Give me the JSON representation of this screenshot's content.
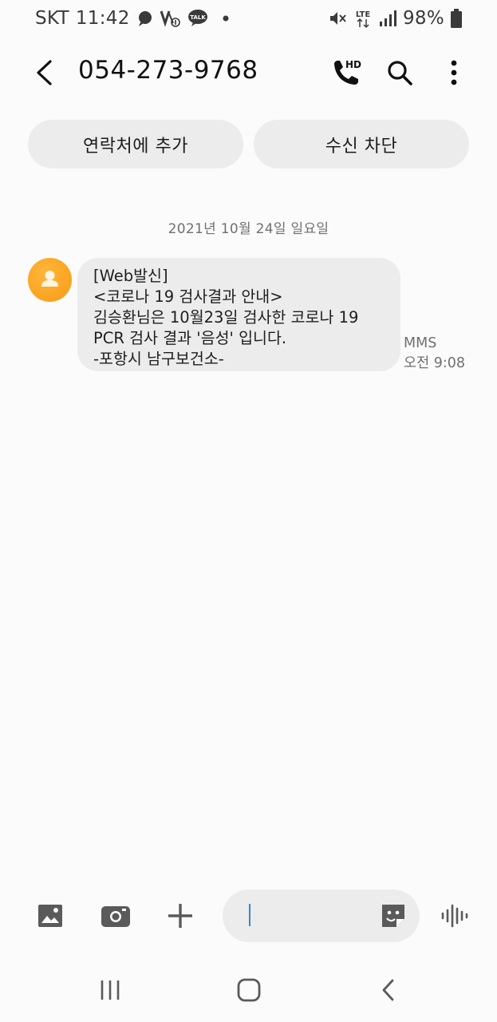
{
  "status_bar": {
    "carrier": "SKT",
    "time": "11:42",
    "network": "LTE",
    "battery": "98%",
    "icons": [
      "chat-bubble-icon",
      "volte-icon",
      "kakaotalk-icon",
      "dot-icon",
      "mute-icon",
      "lte-icon",
      "signal-icon",
      "battery-icon"
    ]
  },
  "app_bar": {
    "title": "054-273-9768",
    "hd_badge": "HD",
    "icons": [
      "back-arrow-icon",
      "hd-call-icon",
      "search-icon",
      "more-vert-icon"
    ]
  },
  "actions": {
    "add_contact": "연락처에 추가",
    "block_number": "수신 차단"
  },
  "thread": {
    "date_divider": "2021년 10월 24일 일요일",
    "message": {
      "lines": [
        "[Web발신]",
        "<코로나 19 검사결과 안내>",
        "김승환님은 10월23일 검사한 코로나 19",
        "PCR 검사 결과 '음성' 입니다.",
        "-포항시 남구보건소-"
      ],
      "type": "MMS",
      "time": "오전 9:08"
    }
  },
  "composer": {
    "icons": [
      "gallery-icon",
      "camera-icon",
      "plus-icon",
      "sticker-icon",
      "voice-icon"
    ],
    "input_value": ""
  },
  "nav_bar": {
    "icons": [
      "recent-apps-icon",
      "home-icon",
      "back-icon"
    ]
  },
  "colors": {
    "background": "#fbfbfb",
    "bubble": "#ececec",
    "avatar": "#f9a825",
    "caret": "#2c8bd8"
  }
}
